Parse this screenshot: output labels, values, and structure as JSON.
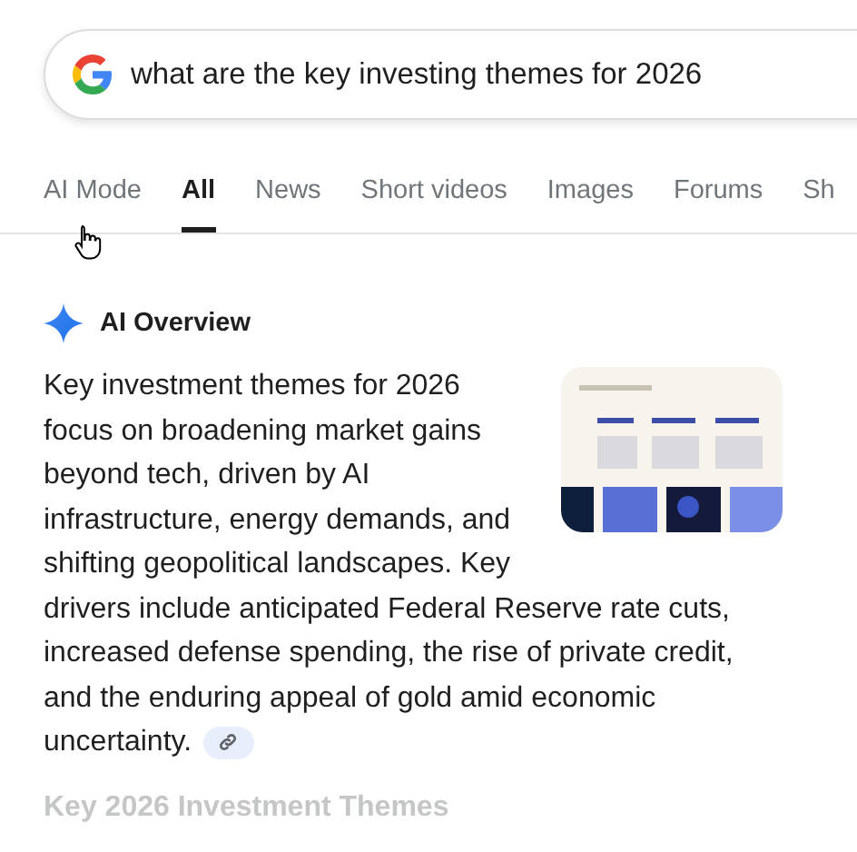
{
  "search": {
    "value": "what are the key investing themes for 2026"
  },
  "tabs": [
    {
      "label": "AI Mode",
      "selected": false
    },
    {
      "label": "All",
      "selected": true
    },
    {
      "label": "News",
      "selected": false
    },
    {
      "label": "Short videos",
      "selected": false
    },
    {
      "label": "Images",
      "selected": false
    },
    {
      "label": "Forums",
      "selected": false
    },
    {
      "label": "Sh",
      "selected": false
    }
  ],
  "overview": {
    "title": "AI Overview",
    "summary_beside": "Key investment themes for 2026 focus on broadening market gains beyond tech, driven by AI infrastructure, energy demands, and shifting geopolitical landscapes. Key",
    "summary_below": "drivers include anticipated Federal Reserve rate cuts, increased defense spending, the rise of private credit, and the enduring appeal of gold amid economic uncertainty.",
    "next_heading": "Key 2026 Investment Themes"
  }
}
